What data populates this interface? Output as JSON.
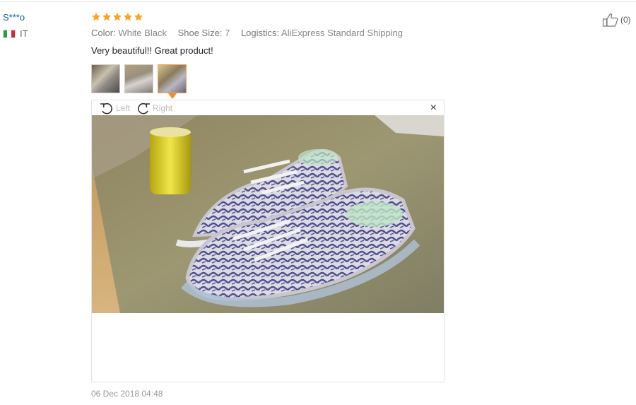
{
  "reviewer": {
    "name": "S***o",
    "country_code": "IT",
    "flag_colors": [
      "#2e9a47",
      "#ffffff",
      "#cf2a3a"
    ]
  },
  "rating": {
    "stars": 5,
    "max": 5,
    "star_color": "#f6a623"
  },
  "attributes": {
    "color_label": "Color:",
    "color_value": "White Black",
    "size_label": "Shoe Size:",
    "size_value": "7",
    "logistics_label": "Logistics:",
    "logistics_value": "AliExpress Standard Shipping"
  },
  "review_text": "Very beautiful!! Great product!",
  "thumbnails": {
    "count": 3,
    "active_index": 2
  },
  "viewer": {
    "rotate_left_label": "Left",
    "rotate_right_label": "Right",
    "close_glyph": "×"
  },
  "likes": {
    "count_text": "(0)"
  },
  "date": "06 Dec 2018 04:48",
  "colors": {
    "link": "#0b5aa8",
    "accent": "#f08a24"
  }
}
